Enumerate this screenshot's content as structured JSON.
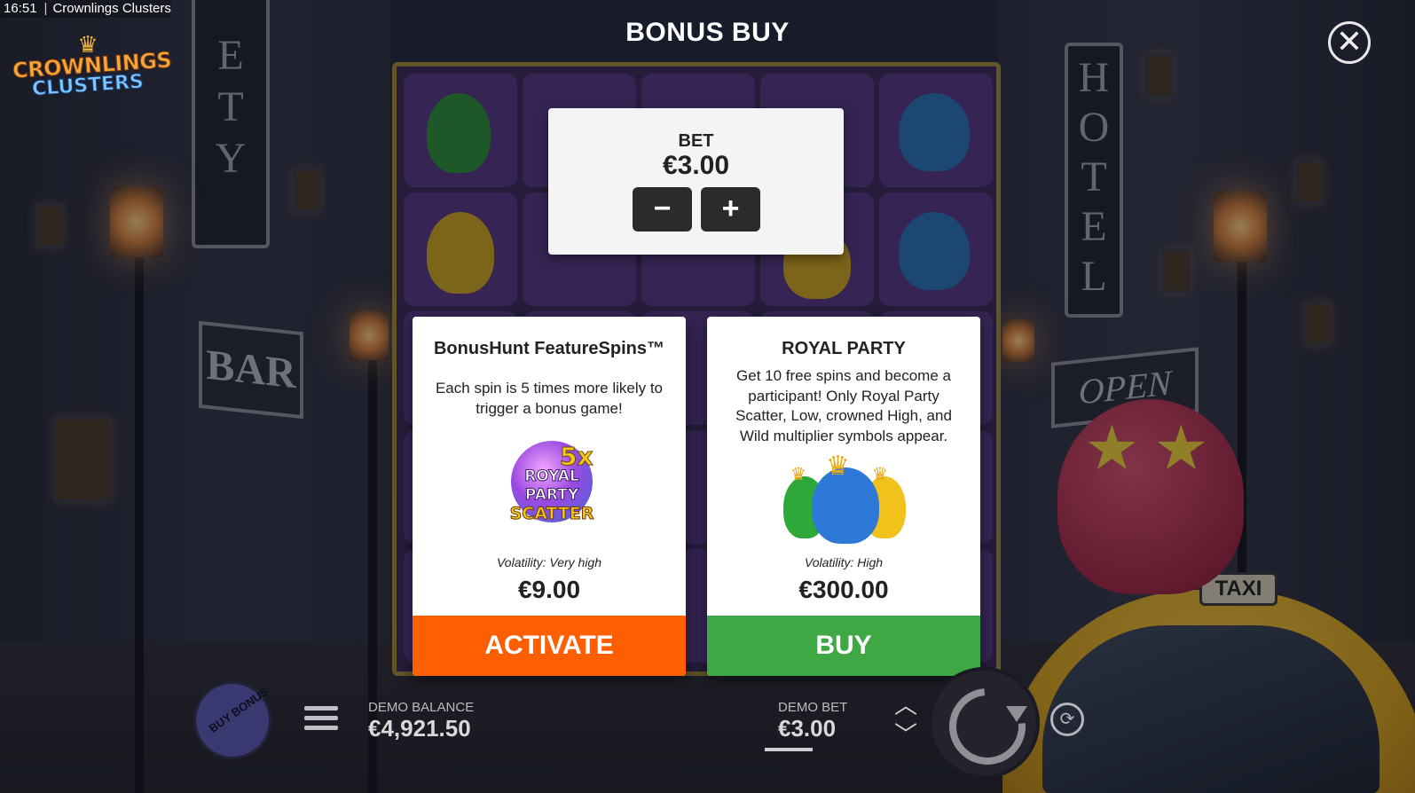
{
  "statusbar": {
    "time": "16:51",
    "app_title": "Crownlings Clusters"
  },
  "logo": {
    "line1": "CROWNLINGS",
    "line2": "CLUSTERS"
  },
  "scene": {
    "sign_left_letters": [
      "E",
      "T",
      "Y"
    ],
    "sign_hotel_letters": [
      "H",
      "O",
      "T",
      "E",
      "L"
    ],
    "sign_bar": "BAR",
    "sign_open": "OPEN",
    "taxi_sign": "TAXI"
  },
  "modal": {
    "title": "BONUS BUY",
    "close_icon": "close-icon",
    "bet": {
      "label": "BET",
      "value": "€3.00",
      "minus": "−",
      "plus": "+"
    },
    "offers": [
      {
        "title": "BonusHunt FeatureSpins™",
        "description": "Each spin is 5 times more likely to trigger a bonus game!",
        "art": {
          "multiplier": "5x",
          "lines": [
            "ROYAL",
            "PARTY",
            "SCATTER"
          ]
        },
        "volatility": "Volatility: Very high",
        "price": "€9.00",
        "action": "ACTIVATE",
        "action_color": "#ff5f00"
      },
      {
        "title": "ROYAL PARTY",
        "description": "Get 10 free spins and become a participant! Only Royal Party Scatter, Low, crowned High, and Wild multiplier symbols appear.",
        "volatility": "Volatility: High",
        "price": "€300.00",
        "action": "BUY",
        "action_color": "#3fa845"
      }
    ]
  },
  "controls": {
    "buy_bonus": "BUY BONUS",
    "demo_balance_label": "DEMO BALANCE",
    "demo_balance_value": "€4,921.50",
    "demo_bet_label": "DEMO BET",
    "demo_bet_value": "€3.00"
  },
  "colors": {
    "activate": "#ff5f00",
    "buy": "#3fa845",
    "board_frame": "#a68a3a"
  }
}
